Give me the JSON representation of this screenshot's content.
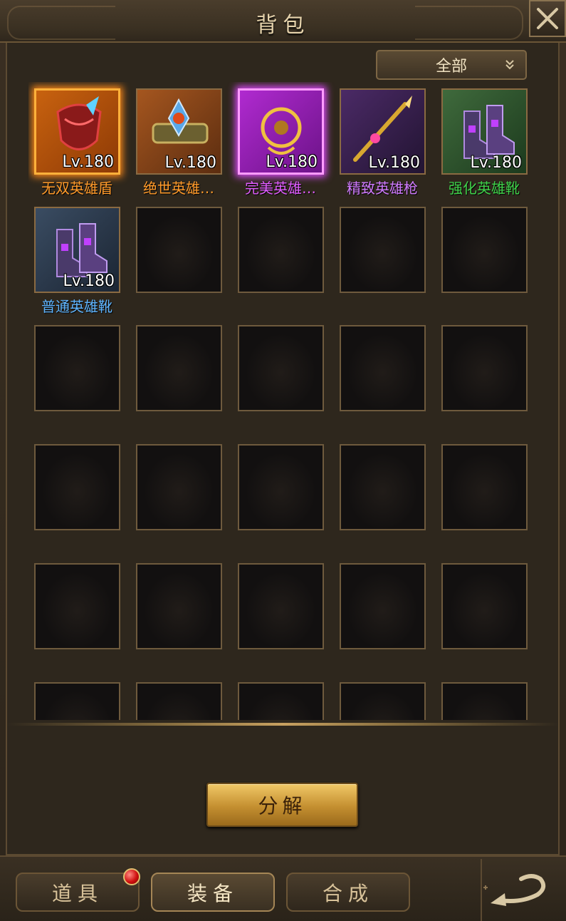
{
  "window": {
    "title": "背包"
  },
  "filter": {
    "selected": "全部"
  },
  "items": [
    {
      "name": "无双英雄盾",
      "level": "Lv.180",
      "rarity": "orange",
      "name_color": "#ff9a2a",
      "icon": "shield-icon"
    },
    {
      "name": "绝世英雄…",
      "level": "Lv.180",
      "rarity": "bronze",
      "name_color": "#ff9a2a",
      "icon": "necklace-icon"
    },
    {
      "name": "完美英雄…",
      "level": "Lv.180",
      "rarity": "magenta",
      "name_color": "#e05cff",
      "icon": "amulet-icon"
    },
    {
      "name": "精致英雄枪",
      "level": "Lv.180",
      "rarity": "purple",
      "name_color": "#d07bff",
      "icon": "spear-icon"
    },
    {
      "name": "强化英雄靴",
      "level": "Lv.180",
      "rarity": "green",
      "name_color": "#3fd14a",
      "icon": "boots-icon"
    },
    {
      "name": "普通英雄靴",
      "level": "Lv.180",
      "rarity": "blue",
      "name_color": "#5fb5ff",
      "icon": "boots-icon"
    }
  ],
  "actions": {
    "decompose_label": "分解"
  },
  "tabs": [
    {
      "label": "道具",
      "active": false,
      "has_notification": true
    },
    {
      "label": "装备",
      "active": true,
      "has_notification": false
    },
    {
      "label": "合成",
      "active": false,
      "has_notification": false
    }
  ]
}
